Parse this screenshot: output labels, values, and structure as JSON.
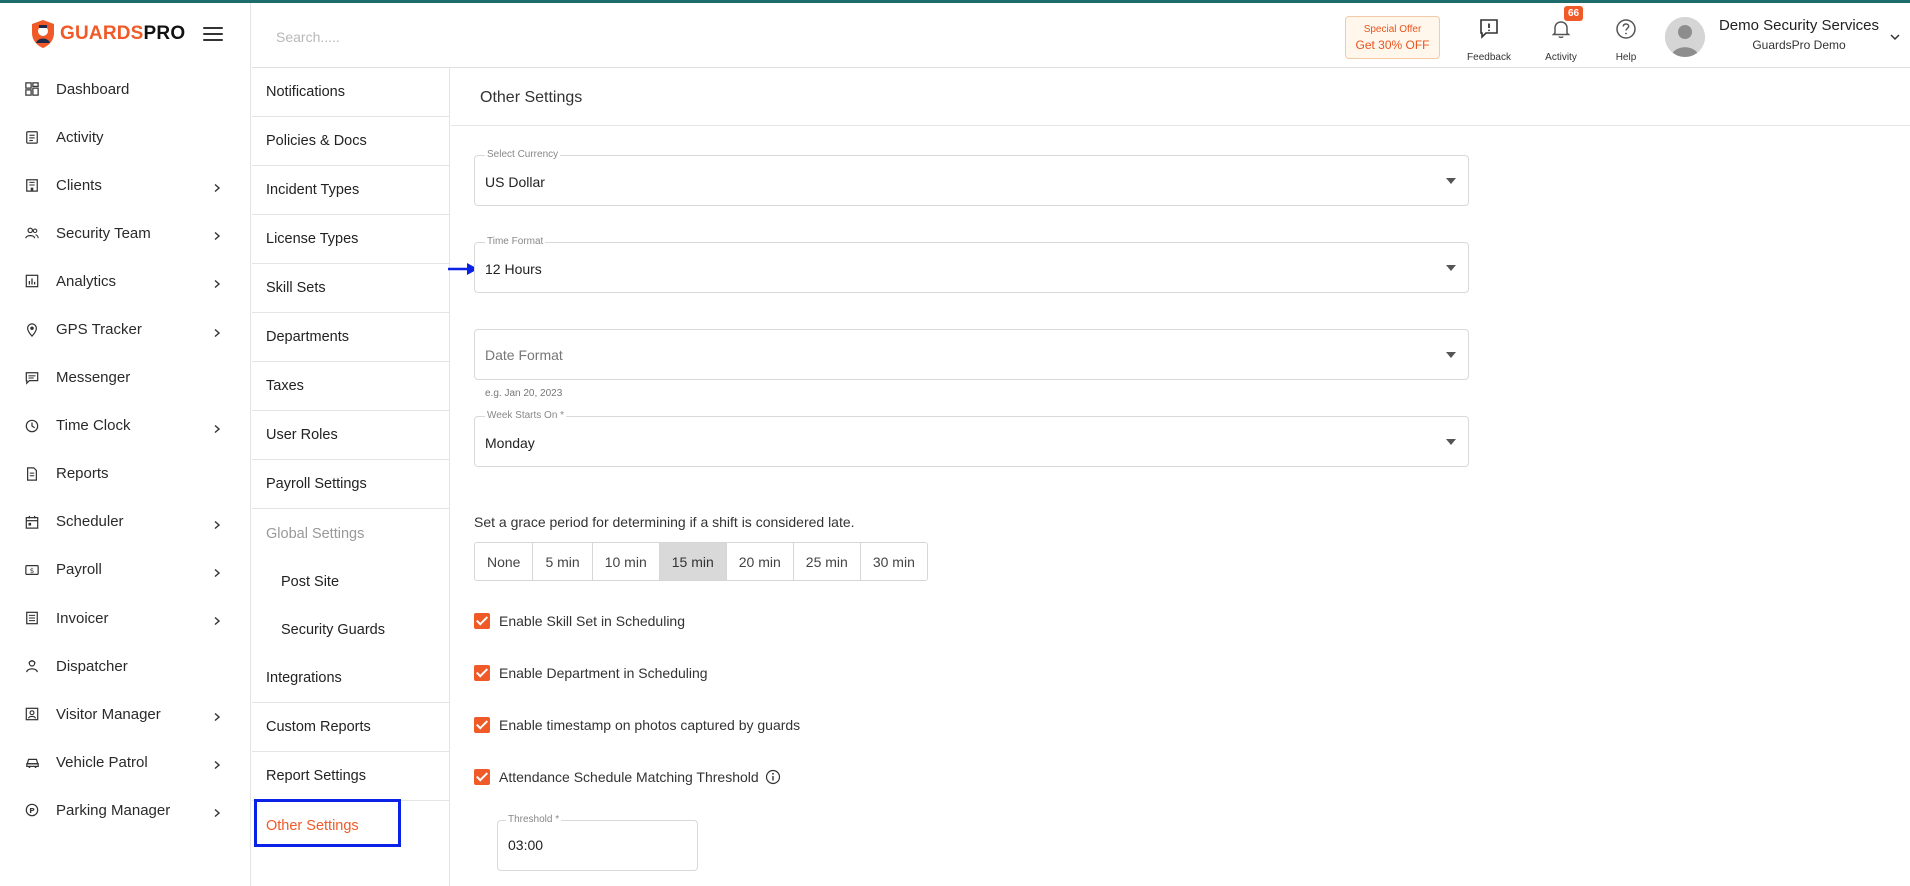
{
  "brand": {
    "name_part1": "GUARDS",
    "name_part2": "PRO",
    "color_primary": "#f05a28",
    "color_accent": "#1e6b6b"
  },
  "nav": {
    "items": [
      {
        "label": "Dashboard",
        "icon": "dashboard-icon",
        "chevron": false
      },
      {
        "label": "Activity",
        "icon": "clipboard-icon",
        "chevron": false
      },
      {
        "label": "Clients",
        "icon": "building-icon",
        "chevron": true
      },
      {
        "label": "Security Team",
        "icon": "team-icon",
        "chevron": true
      },
      {
        "label": "Analytics",
        "icon": "analytics-icon",
        "chevron": true
      },
      {
        "label": "GPS Tracker",
        "icon": "location-pin-icon",
        "chevron": true
      },
      {
        "label": "Messenger",
        "icon": "chat-icon",
        "chevron": false
      },
      {
        "label": "Time Clock",
        "icon": "clock-icon",
        "chevron": true
      },
      {
        "label": "Reports",
        "icon": "document-icon",
        "chevron": false
      },
      {
        "label": "Scheduler",
        "icon": "calendar-icon",
        "chevron": true
      },
      {
        "label": "Payroll",
        "icon": "money-icon",
        "chevron": true
      },
      {
        "label": "Invoicer",
        "icon": "invoice-icon",
        "chevron": true
      },
      {
        "label": "Dispatcher",
        "icon": "dispatcher-icon",
        "chevron": false
      },
      {
        "label": "Visitor Manager",
        "icon": "visitor-icon",
        "chevron": true
      },
      {
        "label": "Vehicle Patrol",
        "icon": "car-icon",
        "chevron": true
      },
      {
        "label": "Parking Manager",
        "icon": "parking-icon",
        "chevron": true
      }
    ]
  },
  "header": {
    "search_placeholder": "Search.....",
    "offer_line1": "Special Offer",
    "offer_line2": "Get 30% OFF",
    "feedback_label": "Feedback",
    "activity_label": "Activity",
    "activity_badge": "66",
    "help_label": "Help",
    "user_name": "Demo Security Services",
    "company_name": "GuardsPro Demo"
  },
  "subnav": {
    "items": [
      {
        "label": "Notifications",
        "type": "item"
      },
      {
        "label": "Policies & Docs",
        "type": "item"
      },
      {
        "label": "Incident Types",
        "type": "item"
      },
      {
        "label": "License Types",
        "type": "item"
      },
      {
        "label": "Skill Sets",
        "type": "item"
      },
      {
        "label": "Departments",
        "type": "item"
      },
      {
        "label": "Taxes",
        "type": "item"
      },
      {
        "label": "User Roles",
        "type": "item"
      },
      {
        "label": "Payroll Settings",
        "type": "item"
      },
      {
        "label": "Global Settings",
        "type": "group"
      },
      {
        "label": "Post Site",
        "type": "child"
      },
      {
        "label": "Security Guards",
        "type": "child"
      },
      {
        "label": "Integrations",
        "type": "item"
      },
      {
        "label": "Custom Reports",
        "type": "item"
      },
      {
        "label": "Report Settings",
        "type": "item"
      },
      {
        "label": "Other Settings",
        "type": "active"
      }
    ]
  },
  "main": {
    "title": "Other Settings",
    "currency": {
      "label": "Select Currency",
      "value": "US Dollar"
    },
    "time_format": {
      "label": "Time Format",
      "value": "12 Hours"
    },
    "date_format": {
      "placeholder": "Date Format",
      "helper": "e.g. Jan 20, 2023"
    },
    "week_start": {
      "label": "Week Starts On *",
      "value": "Monday"
    },
    "grace": {
      "label": "Set a grace period for determining if a shift is considered late.",
      "options": [
        "None",
        "5 min",
        "10 min",
        "15 min",
        "20 min",
        "25 min",
        "30 min"
      ],
      "selected": "15 min"
    },
    "checks": [
      {
        "label": "Enable Skill Set in Scheduling",
        "checked": true
      },
      {
        "label": "Enable Department in Scheduling",
        "checked": true
      },
      {
        "label": "Enable timestamp on photos captured by guards",
        "checked": true
      },
      {
        "label": "Attendance Schedule Matching Threshold",
        "checked": true
      }
    ],
    "threshold": {
      "label": "Threshold *",
      "value": "03:00"
    }
  }
}
